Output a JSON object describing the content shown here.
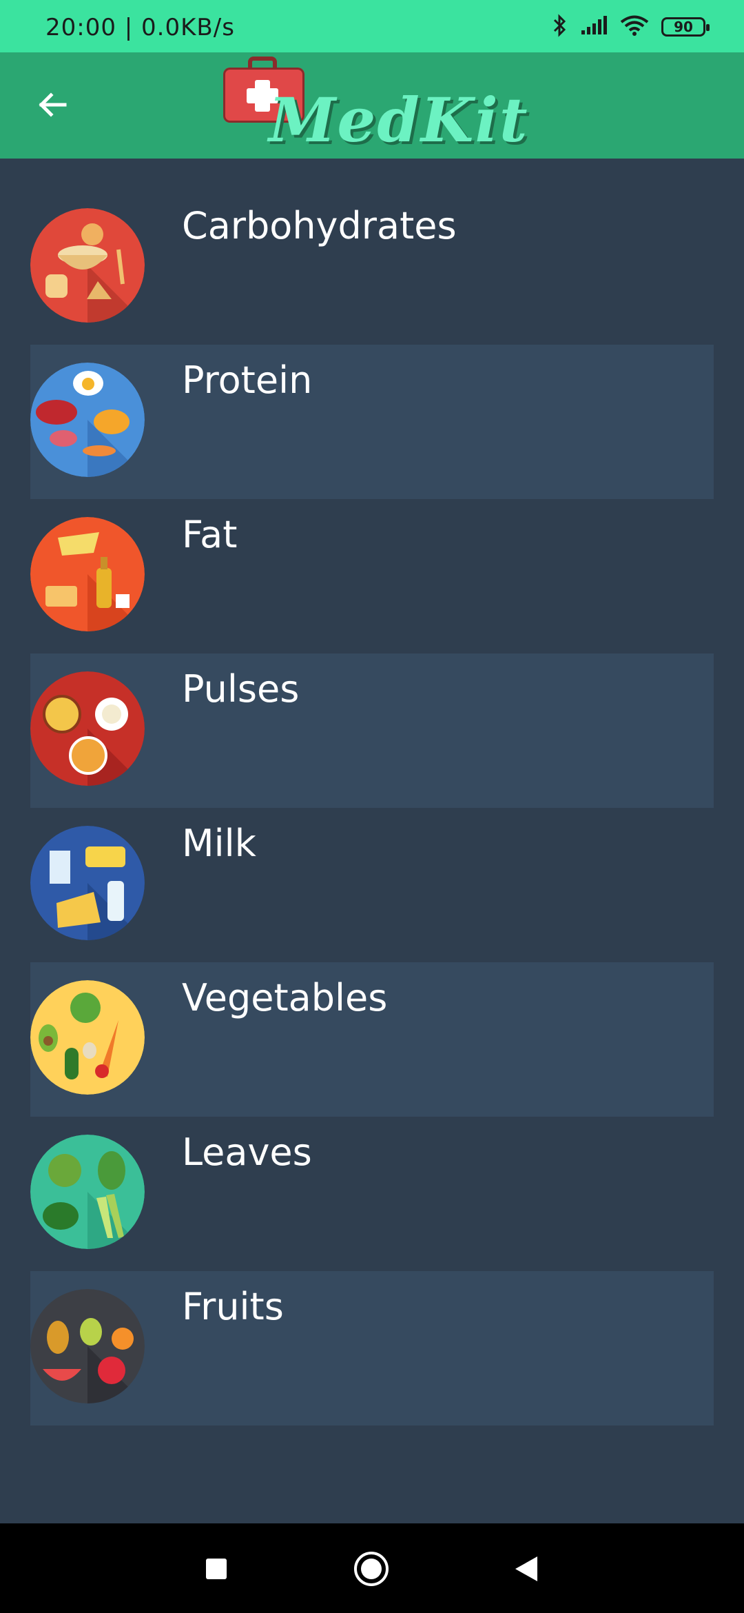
{
  "status_bar": {
    "time": "20:00 | 0.0KB/s",
    "battery": "90",
    "icons": [
      "bluetooth-icon",
      "signal-icon",
      "wifi-icon",
      "battery-icon"
    ]
  },
  "app_bar": {
    "logo_text": "MedKit",
    "background_color": "#2ba772"
  },
  "categories": [
    {
      "label": "Carbohydrates",
      "icon": "carbohydrates-icon",
      "color": "#e0483a"
    },
    {
      "label": "Protein",
      "icon": "protein-icon",
      "color": "#4a90d9"
    },
    {
      "label": "Fat",
      "icon": "fat-icon",
      "color": "#f0562b"
    },
    {
      "label": "Pulses",
      "icon": "pulses-icon",
      "color": "#c63028"
    },
    {
      "label": "Milk",
      "icon": "milk-icon",
      "color": "#2f5aa8"
    },
    {
      "label": "Vegetables",
      "icon": "vegetables-icon",
      "color": "#ffd15a"
    },
    {
      "label": "Leaves",
      "icon": "leaves-icon",
      "color": "#3bbf98"
    },
    {
      "label": "Fruits",
      "icon": "fruits-icon",
      "color": "#3d3f45"
    }
  ]
}
